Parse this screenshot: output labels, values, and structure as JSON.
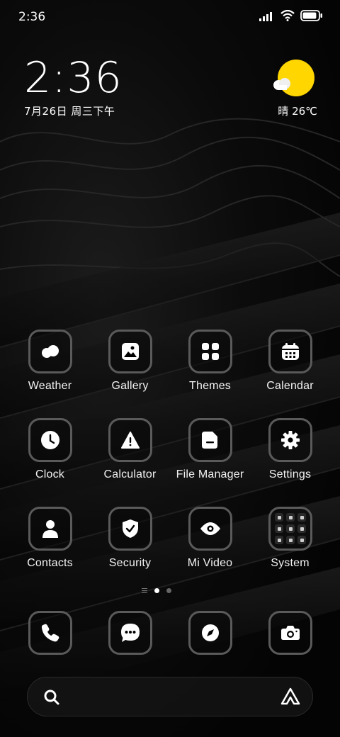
{
  "status_bar": {
    "time": "2:36",
    "battery_level": 0.9
  },
  "clock_widget": {
    "time": "2:36",
    "date": "7月26日 周三下午"
  },
  "weather_widget": {
    "condition": "晴",
    "temperature": "26℃",
    "sun_color": "#ffd600"
  },
  "apps": [
    {
      "label": "Weather",
      "icon": "weather-icon"
    },
    {
      "label": "Gallery",
      "icon": "gallery-icon"
    },
    {
      "label": "Themes",
      "icon": "themes-icon"
    },
    {
      "label": "Calendar",
      "icon": "calendar-icon"
    },
    {
      "label": "Clock",
      "icon": "clock-icon"
    },
    {
      "label": "Calculator",
      "icon": "calculator-icon"
    },
    {
      "label": "File Manager",
      "icon": "file-manager-icon"
    },
    {
      "label": "Settings",
      "icon": "settings-icon"
    },
    {
      "label": "Contacts",
      "icon": "contacts-icon"
    },
    {
      "label": "Security",
      "icon": "security-icon"
    },
    {
      "label": "Mi Video",
      "icon": "mi-video-icon"
    },
    {
      "label": "System",
      "icon": "system-folder-icon"
    }
  ],
  "pager": {
    "pages": 2,
    "current": 1
  },
  "dock": [
    "phone-icon",
    "messages-icon",
    "browser-icon",
    "camera-icon"
  ],
  "search_bar": {
    "left_icon": "search-icon",
    "right_icon": "assistant-icon"
  }
}
